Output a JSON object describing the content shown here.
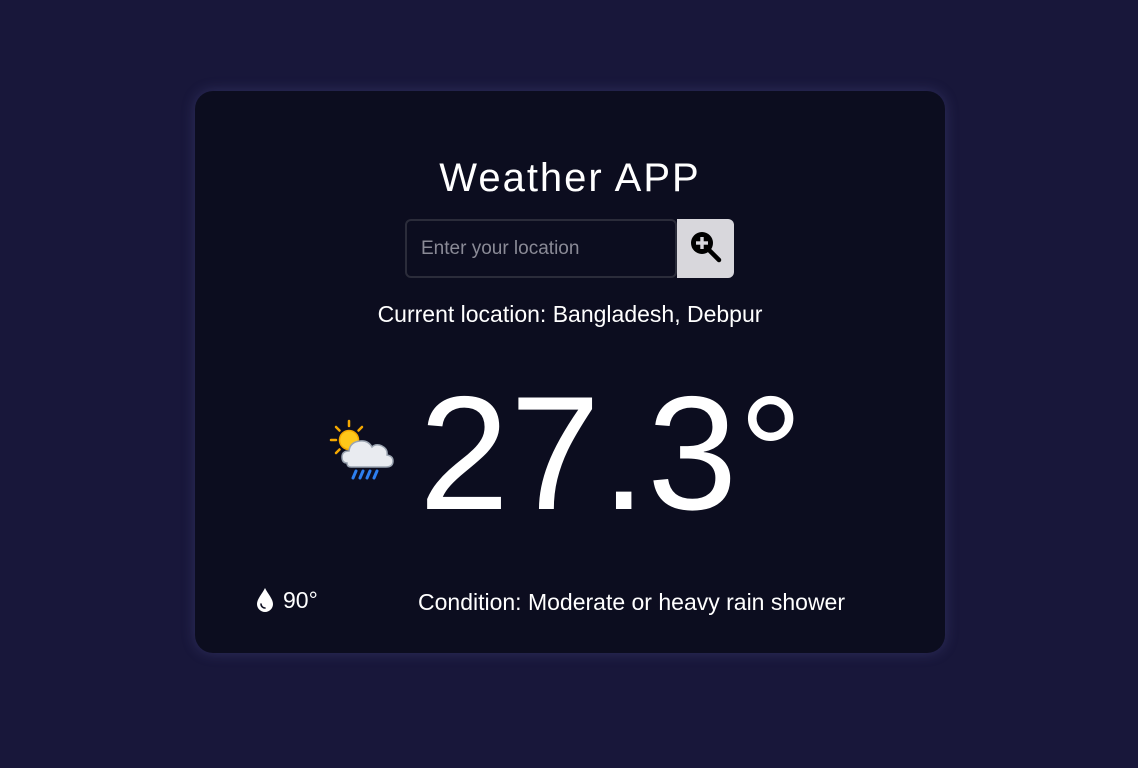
{
  "app": {
    "title": "Weather APP"
  },
  "search": {
    "placeholder": "Enter your location",
    "value": ""
  },
  "location": {
    "text": "Current location: Bangladesh, Debpur"
  },
  "weather": {
    "icon": "sun-cloud-rain-icon",
    "temperature": "27.3°",
    "humidity": "90°",
    "condition": "Condition: Moderate or heavy rain shower"
  },
  "colors": {
    "page_background": "#18173a",
    "card_background": "#0c0d1f",
    "text": "#ffffff",
    "button": "#d8d7dc"
  }
}
